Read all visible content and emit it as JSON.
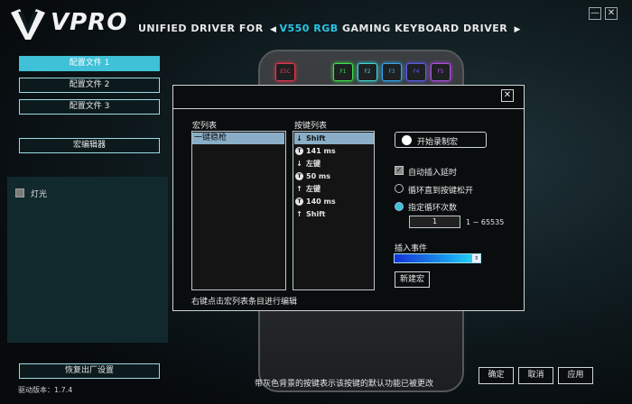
{
  "header": {
    "brand": "VPRO",
    "title_prefix": "UNIFIED DRIVER FOR",
    "prev_arrow": "◀",
    "model": "V550 RGB",
    "title_suffix": "GAMING KEYBOARD DRIVER",
    "next_arrow": "▶",
    "minimize": "—",
    "close": "✕"
  },
  "sidebar": {
    "profiles": [
      {
        "label": "配置文件 1",
        "active": true
      },
      {
        "label": "配置文件 2",
        "active": false
      },
      {
        "label": "配置文件 3",
        "active": false
      }
    ],
    "macro_editor": "宏编辑器",
    "light_label": "灯光",
    "factory_reset": "恢复出厂设置",
    "version": "驱动版本：1.7.4"
  },
  "keyboard": {
    "fkeys": [
      {
        "label": "ESC",
        "color": "#e8344a"
      },
      {
        "label": "F1",
        "color": "#3be34b"
      },
      {
        "label": "F2",
        "color": "#3bd8d4"
      },
      {
        "label": "F3",
        "color": "#35a6ee"
      },
      {
        "label": "F4",
        "color": "#5b5bea"
      },
      {
        "label": "F5",
        "color": "#b04be3"
      }
    ]
  },
  "dialog": {
    "close": "✕",
    "macro_list_title": "宏列表",
    "macro_items": [
      "一键稳枪"
    ],
    "key_list_title": "按键列表",
    "key_items": [
      {
        "icon": "down",
        "text": "Shift"
      },
      {
        "icon": "timer",
        "text": "141 ms"
      },
      {
        "icon": "down",
        "text": "左键"
      },
      {
        "icon": "timer",
        "text": "50 ms"
      },
      {
        "icon": "up",
        "text": "左键"
      },
      {
        "icon": "timer",
        "text": "140 ms"
      },
      {
        "icon": "up",
        "text": "Shift"
      }
    ],
    "hint": "右键点击宏列表条目进行编辑",
    "record_button": "开始录制宏",
    "auto_delay": "自动插入延时",
    "loop_until_release": "循环直到按键松开",
    "loop_count": "指定循环次数",
    "loop_count_value": "1",
    "loop_range": "1 ~ 65535",
    "insert_event_label": "插入事件",
    "new_macro_button": "新建宏"
  },
  "footer": {
    "note": "带灰色背景的按键表示该按键的默认功能已被更改",
    "ok": "确定",
    "cancel": "取消",
    "apply": "应用"
  },
  "colors": {
    "accent": "#3fc1d8",
    "selection": "#8aaec7"
  }
}
